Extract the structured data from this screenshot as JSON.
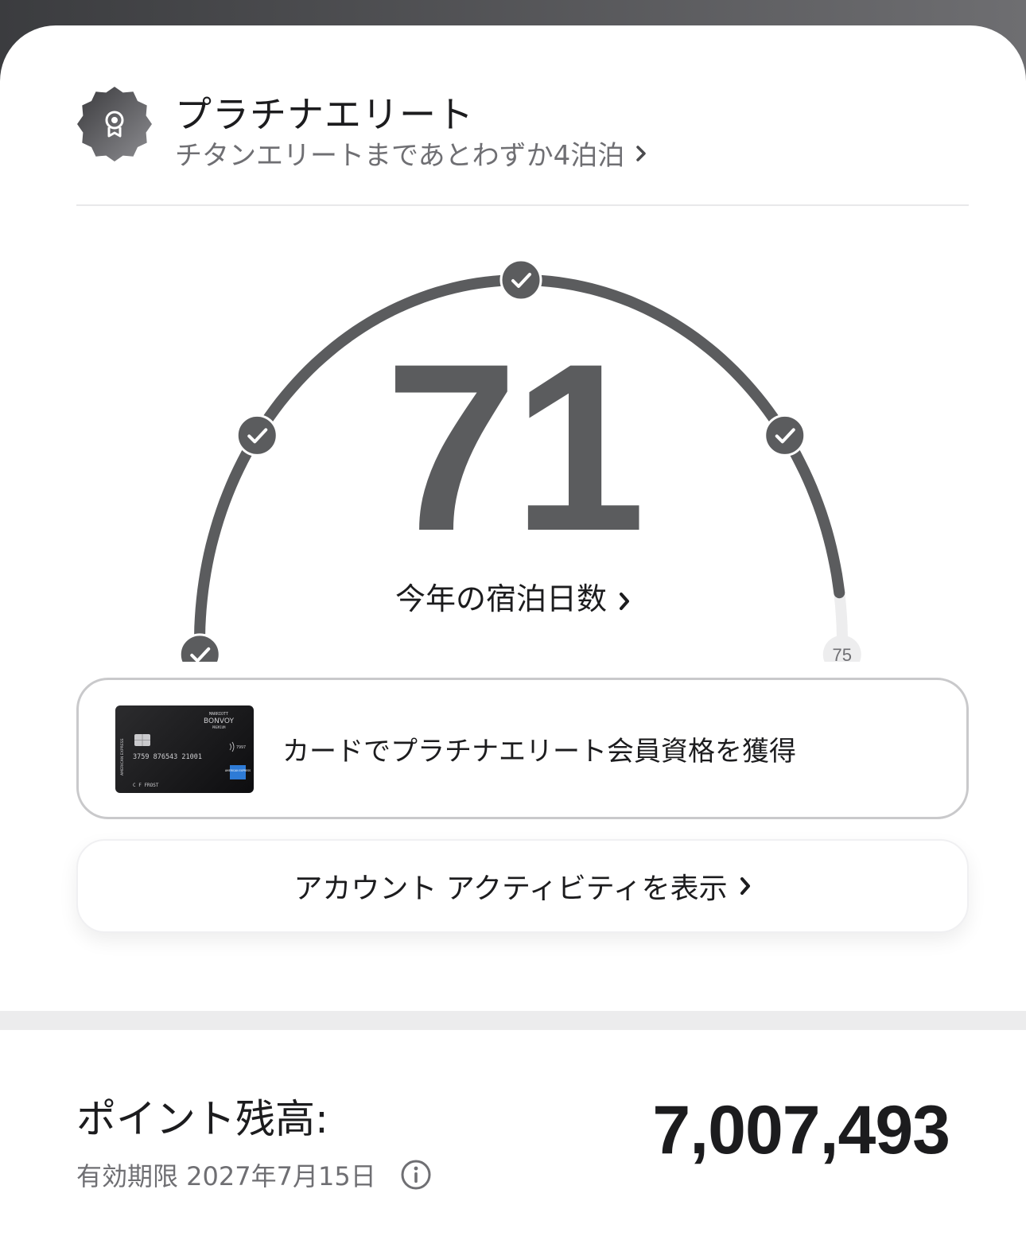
{
  "tier": {
    "name": "プラチナエリート",
    "progress_text": "チタンエリートまであとわずか4泊泊"
  },
  "gauge": {
    "current_nights": "71",
    "goal_label": "75",
    "progress": 0.9467,
    "milestones_achieved": 4,
    "label": "今年の宿泊日数"
  },
  "card_promo": {
    "text": "カードでプラチナエリート会員資格を獲得",
    "card": {
      "brand_top": "MARRIOTT",
      "brand": "BONVOY",
      "tier": "PREMIUM",
      "side_text": "AMERICAN EXPRESS",
      "number": "3759 876543 21001",
      "short_number": "7997",
      "holder": "C F FROST",
      "amex_logo": "AMERICAN EXPRESS"
    }
  },
  "activity_button": {
    "label": "アカウント アクティビティを表示"
  },
  "points": {
    "label": "ポイント残高:",
    "value": "7,007,493",
    "expiry": "有効期限 2027年7月15日"
  },
  "icons": {
    "badge": "award-badge-icon",
    "chevron": "chevron-right-icon",
    "check": "check-icon",
    "info": "info-icon"
  },
  "colors": {
    "gauge_fill": "#5b5c5e",
    "gauge_track": "#ededee",
    "text_primary": "#1c1c1e",
    "text_secondary": "#6f6f73"
  }
}
